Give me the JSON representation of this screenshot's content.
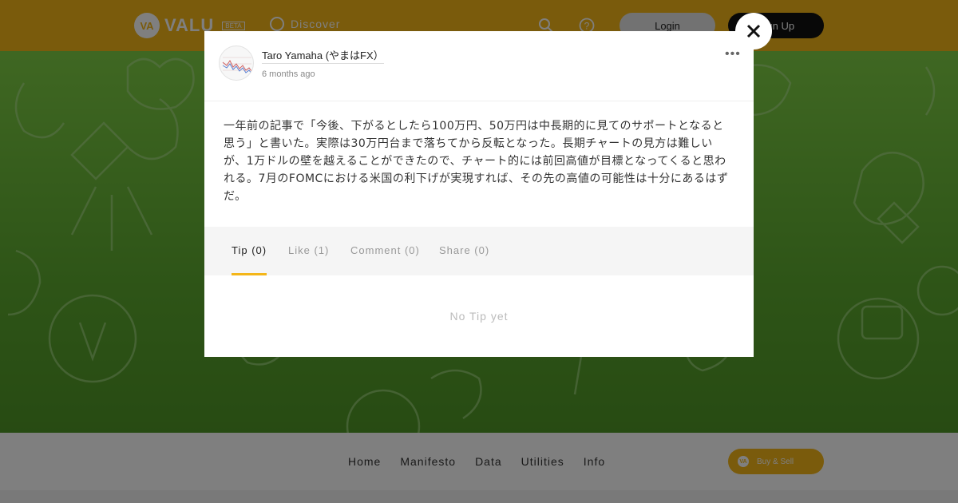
{
  "header": {
    "logo_mark": "VA",
    "logo_text": "VALU",
    "beta_badge": "BETA",
    "discover_label": "Discover",
    "login_label": "Login",
    "signup_label": "Sign Up"
  },
  "modal": {
    "author_name": "Taro Yamaha (やまはFX）",
    "timestamp": "6 months ago",
    "more_label": "•••",
    "body": "一年前の記事で「今後、下がるとしたら100万円、50万円は中長期的に見てのサポートとなると思う」と書いた。実際は30万円台まで落ちてから反転となった。長期チャートの見方は難しいが、1万ドルの壁を越えることができたので、チャート的には前回高値が目標となってくると思われる。7月のFOMCにおける米国の利下げが実現すれば、その先の高値の可能性は十分にあるはずだ。",
    "tabs": [
      {
        "label": "Tip (0)",
        "active": true
      },
      {
        "label": "Like (1)",
        "active": false
      },
      {
        "label": "Comment (0)",
        "active": false
      },
      {
        "label": "Share (0)",
        "active": false
      }
    ],
    "empty_message": "No Tip yet",
    "close_label": "×"
  },
  "footer": {
    "links": [
      "Home",
      "Manifesto",
      "Data",
      "Utilities",
      "Info"
    ],
    "buysell_label": "Buy & Sell",
    "buysell_mark": "VA"
  },
  "colors": {
    "brand": "#f4b619",
    "hero_green": "#5daa2f",
    "overlay": "rgba(0,0,0,0.5)"
  }
}
